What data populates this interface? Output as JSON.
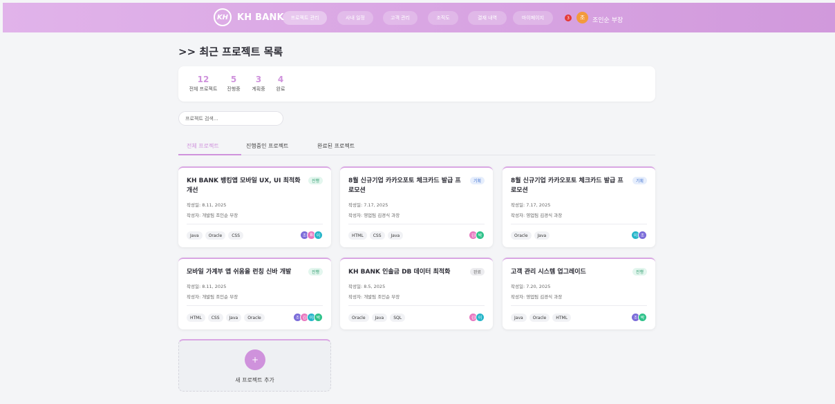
{
  "header": {
    "logo_mark": "KH",
    "logo_text": "KH BANK",
    "nav": [
      "프로젝트 관리",
      "사내 일정",
      "고객 관리",
      "조직도",
      "결재 내역",
      "마이페이지"
    ],
    "notification_count": "3",
    "user_initial": "조",
    "user_name": "조인순 부장"
  },
  "page_title": ">> 최근 프로젝트 목록",
  "stats": [
    {
      "value": "12",
      "label": "전체 프로젝트"
    },
    {
      "value": "5",
      "label": "진행중"
    },
    {
      "value": "3",
      "label": "계획중"
    },
    {
      "value": "4",
      "label": "완료"
    }
  ],
  "search": {
    "placeholder": "프로젝트 검색..."
  },
  "tabs": [
    "전체 프로젝트",
    "진행중인 프로젝트",
    "완료된 프로젝트"
  ],
  "cards": [
    {
      "title": "KH BANK 뱅킹앱 모바일 UX, UI 최적화 개선",
      "status": "진행",
      "date": "작성일: 8.11, 2025",
      "author": "작성자: 개발팀 조인순 부장",
      "tags": [
        "Java",
        "Oracle",
        "CSS"
      ],
      "avatars": [
        "조",
        "B",
        "이"
      ]
    },
    {
      "title": "8월 신규기업 카카오포토 체크카드 발급 프로모션",
      "status": "기획",
      "date": "작성일: 7.17, 2025",
      "author": "작성자: 영업팀 김경식 과장",
      "tags": [
        "HTML",
        "CSS",
        "Java"
      ],
      "avatars": [
        "김",
        "박"
      ]
    },
    {
      "title": "8월 신규기업 카카오포토 체크카드 발급 프로모션",
      "status": "기획",
      "date": "작성일: 7.17, 2025",
      "author": "작성자: 영업팀 김경식 과장",
      "tags": [
        "Oracle",
        "Java"
      ],
      "avatars": [
        "이",
        "조"
      ]
    },
    {
      "title": "모바일 가계부 앱 쉬움을 런칭 신바 개발",
      "status": "진행",
      "date": "작성일: 8.11, 2025",
      "author": "작성자: 개발팀 조인순 부장",
      "tags": [
        "HTML",
        "CSS",
        "Java",
        "Oracle"
      ],
      "avatars": [
        "조",
        "김",
        "이",
        "박"
      ]
    },
    {
      "title": "KH BANK 인솔금 DB 데이터 최적화",
      "status": "완료",
      "date": "작성일: 8.5, 2025",
      "author": "작성자: 개발팀 조인순 부장",
      "tags": [
        "Oracle",
        "Java",
        "SQL"
      ],
      "avatars": [
        "김",
        "이"
      ]
    },
    {
      "title": "고객 관리 시스템 업그레이드",
      "status": "진행",
      "date": "작성일: 7.20, 2025",
      "author": "작성자: 영업팀 김경식 과장",
      "tags": [
        "Java",
        "Oracle",
        "HTML"
      ],
      "avatars": [
        "조",
        "박"
      ]
    }
  ],
  "add_card": {
    "icon": "+",
    "label": "새 프로젝트 추가"
  },
  "colors": {
    "accent": "#cf92dc",
    "header_start": "#e1b3ea",
    "header_end": "#d199dc"
  }
}
